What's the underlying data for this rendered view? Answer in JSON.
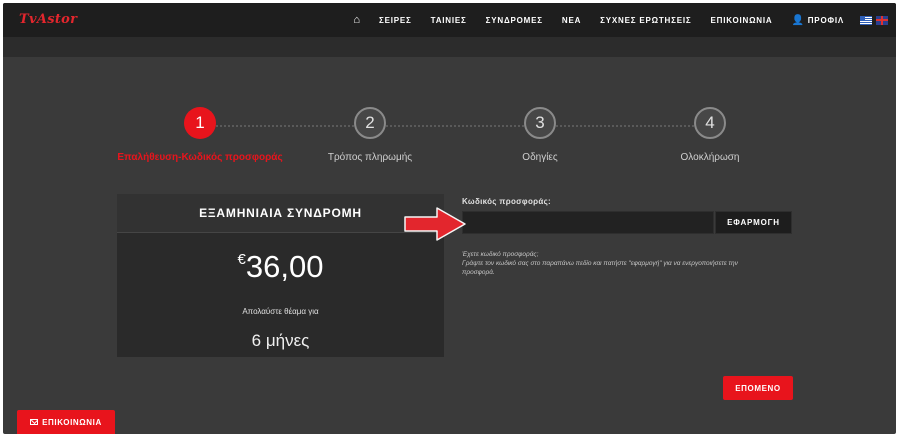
{
  "header": {
    "logo": "TvAstor",
    "nav": {
      "series": "ΣΕΙΡΕΣ",
      "movies": "ΤΑΙΝΙΕΣ",
      "subscriptions": "ΣΥΝΔΡΟΜΕΣ",
      "news": "ΝΕΑ",
      "faq": "ΣΥΧΝΕΣ ΕΡΩΤΗΣΕΙΣ",
      "contact": "ΕΠΙΚΟΙΝΩΝΙΑ",
      "profile": "ΠΡΟΦΙΛ"
    },
    "icons": {
      "home": "home-icon",
      "user": "user-icon",
      "lang_gr": "greek-flag-icon",
      "lang_en": "uk-flag-icon"
    }
  },
  "steps": [
    {
      "number": "1",
      "label": "Επαλήθευση-Κωδικός προσφοράς",
      "active": true
    },
    {
      "number": "2",
      "label": "Τρόπος πληρωμής",
      "active": false
    },
    {
      "number": "3",
      "label": "Οδηγίες",
      "active": false
    },
    {
      "number": "4",
      "label": "Ολοκλήρωση",
      "active": false
    }
  ],
  "plan": {
    "title": "ΕΞΑΜΗΝΙΑΙΑ ΣΥΝΔΡΟΜΗ",
    "currency": "€",
    "price": "36,00",
    "text": "Απολαύστε θέαμα για",
    "duration": "6 μήνες"
  },
  "promo": {
    "label": "Κωδικός προσφοράς:",
    "value": "",
    "placeholder": "",
    "apply_label": "ΕΦΑΡΜΟΓΗ",
    "hint_line1": "Έχετε κωδικό προσφοράς;",
    "hint_line2": "Γράψτε τον κωδικό σας στο παραπάνω πεδίο και πατήστε \"εφαρμογή\" για να ενεργοποιήσετε την προσφορά."
  },
  "next_label": "ΕΠΟΜΕΝΟ",
  "contact_label": "ΕΠΙΚΟΙΝΩΝΙΑ",
  "colors": {
    "accent": "#e8141c",
    "background": "#3a3a3a",
    "topbar": "#1e1e1e",
    "card": "#2a2a2a"
  }
}
